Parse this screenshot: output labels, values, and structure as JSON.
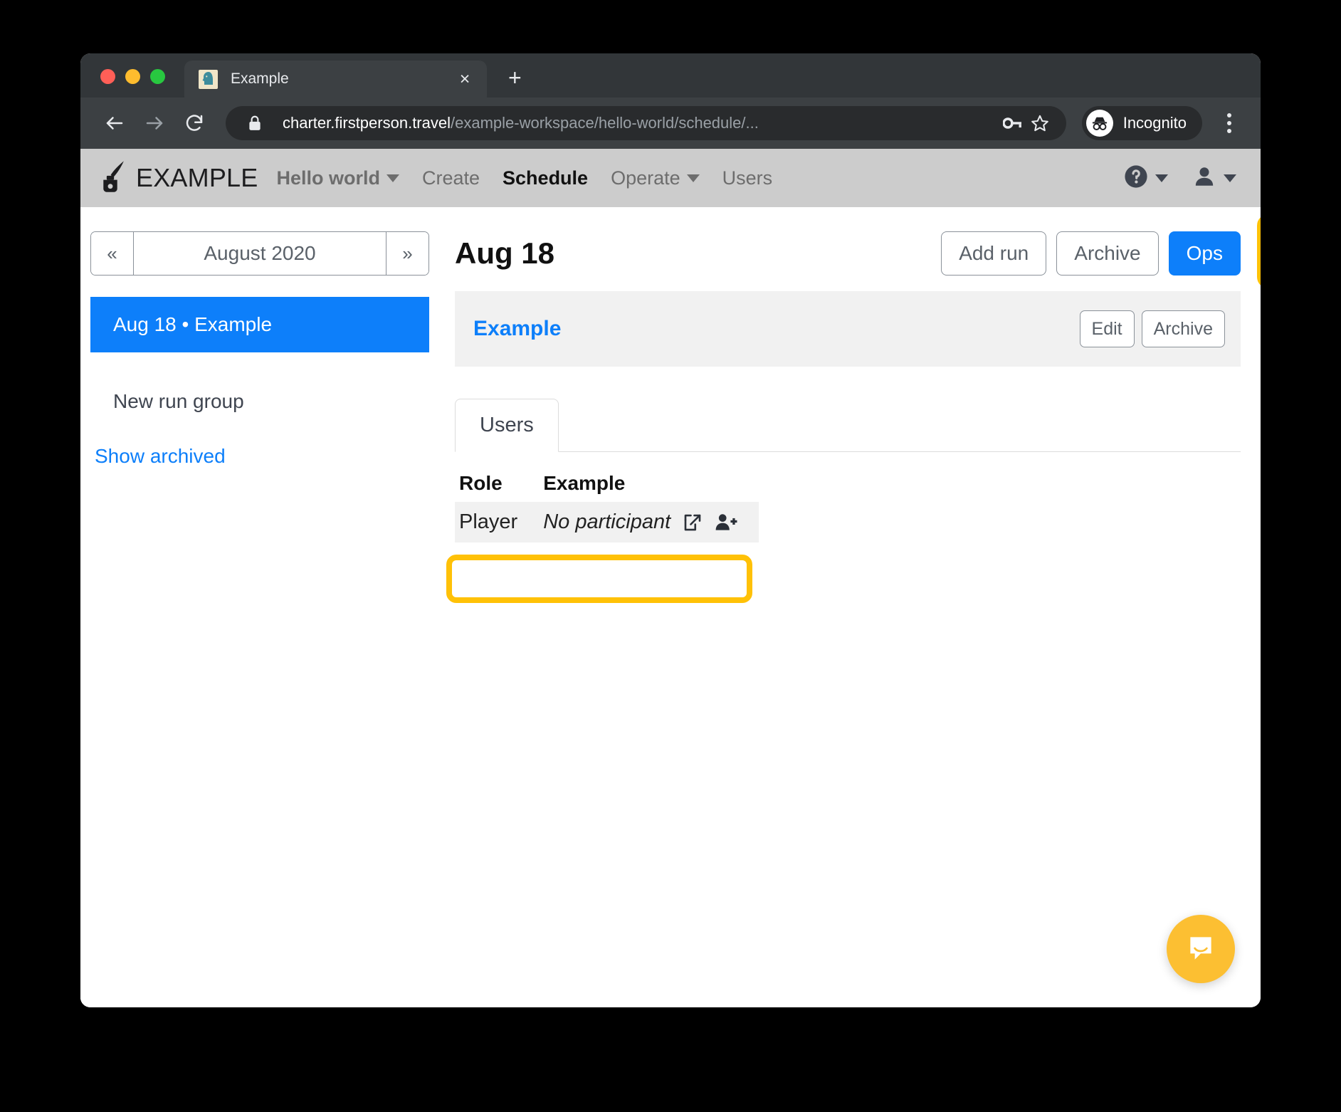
{
  "browser": {
    "tab": {
      "title": "Example",
      "favicon": "chess-knight-icon",
      "close_label": "×"
    },
    "new_tab_label": "+",
    "toolbar": {
      "back_icon": "back-arrow-icon",
      "forward_icon": "forward-arrow-icon",
      "reload_icon": "reload-icon",
      "lock_icon": "lock-icon",
      "url_host": "charter.firstperson.travel",
      "url_path": "/example-workspace/hello-world/schedule/...",
      "key_icon": "key-icon",
      "star_icon": "star-icon",
      "profile_label": "Incognito",
      "profile_icon": "incognito-hat-glasses-icon",
      "menu_icon": "kebab-menu-icon"
    }
  },
  "app": {
    "navbar": {
      "logo_icon": "inkwell-quill-icon",
      "brand": "EXAMPLE",
      "workspace": "Hello world",
      "items": [
        {
          "label": "Create",
          "active": false
        },
        {
          "label": "Schedule",
          "active": true
        },
        {
          "label": "Operate",
          "active": false,
          "caret": true
        },
        {
          "label": "Users",
          "active": false
        }
      ],
      "help_icon": "help-circle-icon",
      "account_icon": "user-avatar-icon"
    },
    "sidebar": {
      "prev_label": "«",
      "next_label": "»",
      "month": "August 2020",
      "run_groups": [
        {
          "label": "Aug 18 • Example",
          "selected": true
        },
        {
          "label": "New run group",
          "selected": false
        }
      ],
      "show_archived": "Show archived"
    },
    "main": {
      "title": "Aug 18",
      "actions": {
        "add_run": "Add run",
        "archive": "Archive",
        "ops": "Ops"
      },
      "run_card": {
        "title": "Example",
        "edit": "Edit",
        "archive": "Archive"
      },
      "tabs": [
        {
          "label": "Users",
          "active": true
        }
      ],
      "users_table": {
        "columns": [
          "Role",
          "Example"
        ],
        "rows": [
          {
            "role": "Player",
            "participant": "No participant",
            "open_icon": "external-link-icon",
            "add_icon": "add-person-icon"
          }
        ]
      }
    },
    "intercom_icon": "chat-bubble-icon"
  },
  "colors": {
    "accent_blue": "#0d7ffa",
    "highlight_yellow": "#ffc107",
    "navbar_gray": "#cccccc",
    "card_gray": "#f1f1f1",
    "intercom_yellow": "#fcbf32"
  }
}
